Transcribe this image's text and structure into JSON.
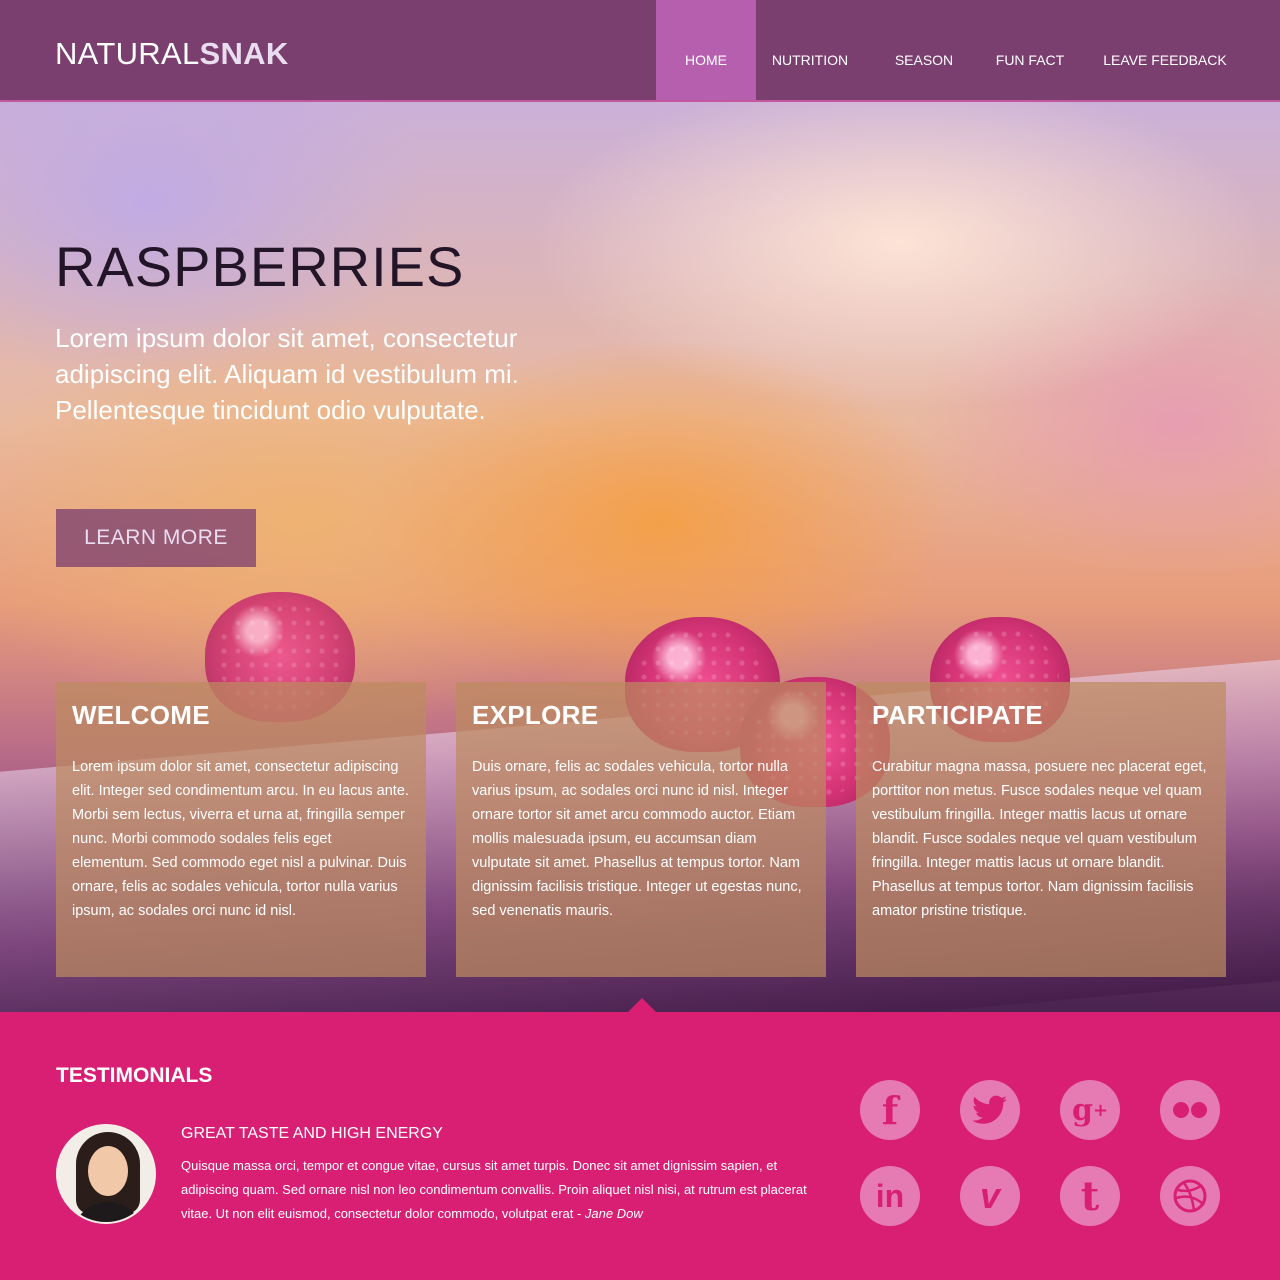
{
  "header": {
    "logo_light": "NATURAL",
    "logo_bold": "SNAK",
    "nav": [
      {
        "label": "HOME",
        "active": true
      },
      {
        "label": "NUTRITION",
        "active": false
      },
      {
        "label": "SEASON",
        "active": false
      },
      {
        "label": "FUN FACT",
        "active": false
      },
      {
        "label": "LEAVE FEEDBACK",
        "active": false
      }
    ]
  },
  "hero": {
    "title": "RASPBERRIES",
    "text": "Lorem ipsum dolor sit amet, consectetur adipiscing elit. Aliquam id vestibulum mi. Pellentesque tincidunt odio vulputate.",
    "button_label": "LEARN MORE"
  },
  "cards": [
    {
      "title": "WELCOME",
      "text": "Lorem ipsum dolor sit amet, consectetur adipiscing elit. Integer sed condimentum arcu. In eu lacus ante. Morbi sem lectus, viverra et urna at, fringilla semper nunc. Morbi commodo sodales felis eget elementum. Sed commodo eget nisl a pulvinar. Duis ornare, felis ac sodales vehicula, tortor nulla varius ipsum, ac sodales orci nunc id nisl."
    },
    {
      "title": "EXPLORE",
      "text": "Duis ornare, felis ac sodales vehicula, tortor nulla varius ipsum, ac sodales orci nunc id nisl. Integer ornare tortor sit amet arcu commodo auctor. Etiam mollis malesuada ipsum, eu accumsan diam vulputate sit amet. Phasellus at tempus tortor. Nam dignissim facilisis tristique. Integer ut egestas nunc, sed venenatis mauris."
    },
    {
      "title": "PARTICIPATE",
      "text": "Curabitur magna massa, posuere nec placerat eget, porttitor non metus. Fusce sodales neque vel quam vestibulum fringilla. Integer mattis lacus ut ornare blandit. Fusce sodales neque vel quam vestibulum fringilla. Integer mattis lacus ut ornare blandit. Phasellus at tempus tortor. Nam dignissim facilisis amator pristine tristique."
    }
  ],
  "testimonials": {
    "title": "TESTIMONIALS",
    "quote_title": "GREAT TASTE AND HIGH ENERGY",
    "quote_text": "Quisque massa orci, tempor et congue vitae, cursus sit amet turpis. Donec sit amet dignissim sapien, et adipiscing quam. Sed ornare nisl non leo condimentum convallis. Proin aliquet nisl nisi, at rutrum est placerat vitae. Ut non elit euismod, consectetur dolor commodo, volutpat erat - ",
    "author": "Jane Dow"
  },
  "social": [
    {
      "name": "facebook-icon",
      "glyph": "f"
    },
    {
      "name": "twitter-icon",
      "glyph": "🐦"
    },
    {
      "name": "google-plus-icon",
      "glyph": "g+"
    },
    {
      "name": "flickr-icon",
      "glyph": "●●"
    },
    {
      "name": "linkedin-icon",
      "glyph": "in"
    },
    {
      "name": "vimeo-icon",
      "glyph": "v"
    },
    {
      "name": "tumblr-icon",
      "glyph": "t"
    },
    {
      "name": "dribbble-icon",
      "glyph": "◎"
    }
  ],
  "colors": {
    "header_bg": "#7a3e6f",
    "nav_active": "#b75faf",
    "testimonials_bg": "#d91f73",
    "social_icon": "#e57bb2"
  }
}
